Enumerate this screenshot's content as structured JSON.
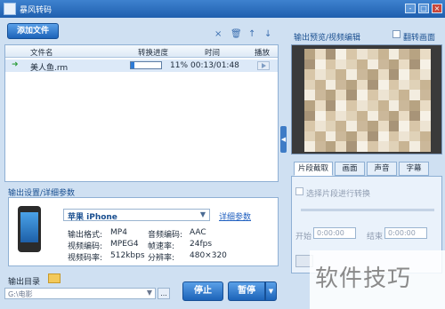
{
  "app": {
    "title": "暴风转码"
  },
  "window_controls": {
    "min": "-",
    "max": "□",
    "close": "×"
  },
  "toolbar": {
    "add_file": "添加文件",
    "delete_icon": "×",
    "trash_icon": "🗑",
    "up_icon": "↑",
    "down_icon": "↓"
  },
  "file_table": {
    "headers": [
      "文件名",
      "转换进度",
      "时间",
      "播放"
    ],
    "rows": [
      {
        "name": "美人鱼.rm",
        "progress_pct": 11,
        "progress_label": "11%",
        "time": "00:13/01:48"
      }
    ]
  },
  "output_settings": {
    "title": "输出设置/详细参数",
    "device": "苹果 iPhone",
    "detail_link": "详细参数",
    "params": [
      {
        "label": "输出格式:",
        "value": "MP4"
      },
      {
        "label": "音频编码:",
        "value": "AAC"
      },
      {
        "label": "视频编码:",
        "value": "MPEG4"
      },
      {
        "label": "帧速率:",
        "value": "24fps"
      },
      {
        "label": "视频码率:",
        "value": "512kbps"
      },
      {
        "label": "分辨率:",
        "value": "480×320"
      }
    ]
  },
  "output_dir": {
    "label": "输出目录",
    "path": "G:\\电影",
    "browse": "..."
  },
  "actions": {
    "stop": "停止",
    "pause": "暂停"
  },
  "preview": {
    "title": "输出预览/视频编辑",
    "flip_label": "翻转画面",
    "tabs": [
      "片段截取",
      "画面",
      "声音",
      "字幕"
    ],
    "segment_check": "选择片段进行转换",
    "start_label": "开始",
    "start_value": "0:00:00",
    "end_label": "结束",
    "end_value": "0:00:00"
  },
  "watermark": "软件技巧",
  "colors": {
    "titlebar": "#2a6dbf",
    "accent": "#1c63b8",
    "panel_bg": "#cfe0f2"
  }
}
